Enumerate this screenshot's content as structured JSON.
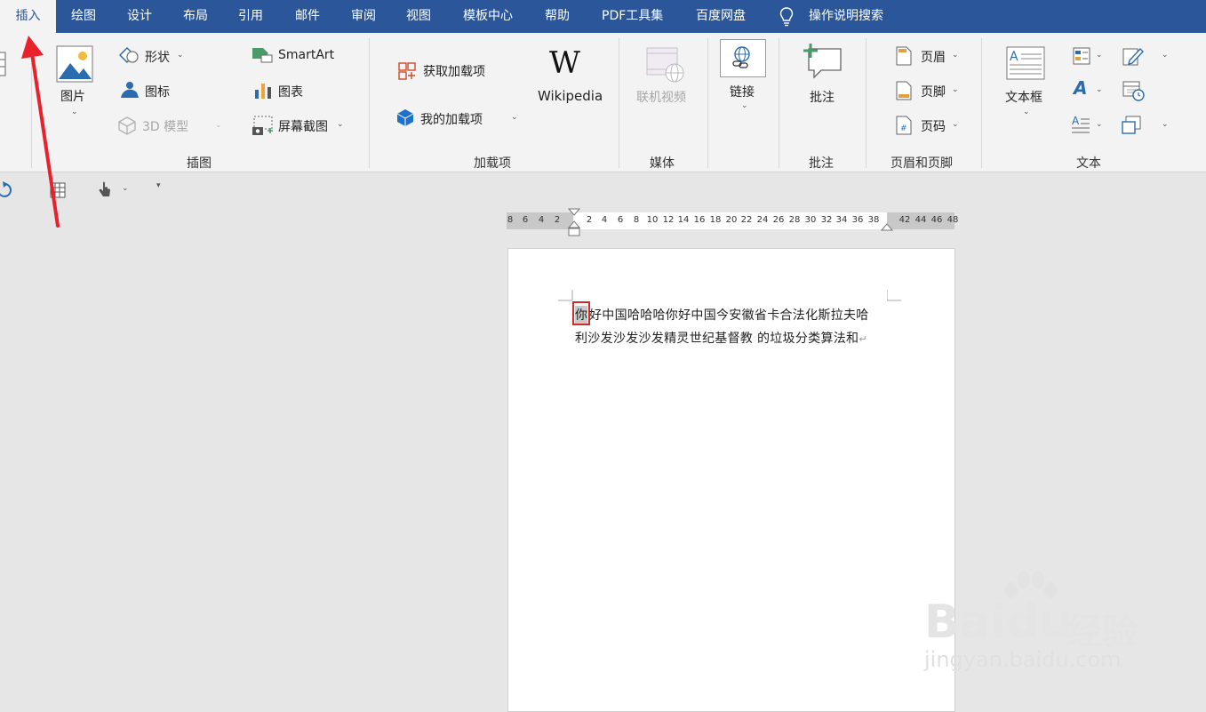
{
  "tabs": [
    "插入",
    "绘图",
    "设计",
    "布局",
    "引用",
    "邮件",
    "审阅",
    "视图",
    "模板中心",
    "帮助",
    "PDF工具集",
    "百度网盘"
  ],
  "search_label": "操作说明搜索",
  "ribbon": {
    "illustrations": {
      "picture": "图片",
      "shapes": "形状",
      "icons": "图标",
      "model3d": "3D 模型",
      "smartart": "SmartArt",
      "chart": "图表",
      "screenshot": "屏幕截图",
      "group": "插图"
    },
    "addins": {
      "get": "获取加载项",
      "mine": "我的加载项",
      "wikipedia": "Wikipedia",
      "group": "加载项"
    },
    "media": {
      "online_video": "联机视频",
      "group": "媒体"
    },
    "links": {
      "link": "链接"
    },
    "comments": {
      "comment": "批注",
      "group": "批注"
    },
    "header_footer": {
      "header": "页眉",
      "footer": "页脚",
      "page_number": "页码",
      "group": "页眉和页脚"
    },
    "text": {
      "textbox": "文本框",
      "group": "文本"
    }
  },
  "ruler_ticks": [
    "8",
    "6",
    "4",
    "2",
    "2",
    "4",
    "6",
    "8",
    "10",
    "12",
    "14",
    "16",
    "18",
    "20",
    "22",
    "24",
    "26",
    "28",
    "30",
    "32",
    "34",
    "36",
    "38",
    "42",
    "44",
    "46",
    "48"
  ],
  "document": {
    "selected_char": "你",
    "line1_rest": "好中国哈哈哈你好中国今安徽省卡合法化斯拉夫哈",
    "line2": "利沙发沙发沙发精灵世纪基督教 的垃圾分类算法和"
  },
  "watermark": {
    "brand": "Baidu",
    "cn": "经验",
    "url": "jingyan.baidu.com"
  },
  "colors": {
    "word_blue": "#2b579a",
    "arrow_red": "#e8212b",
    "selection_red": "#d22b2b"
  }
}
